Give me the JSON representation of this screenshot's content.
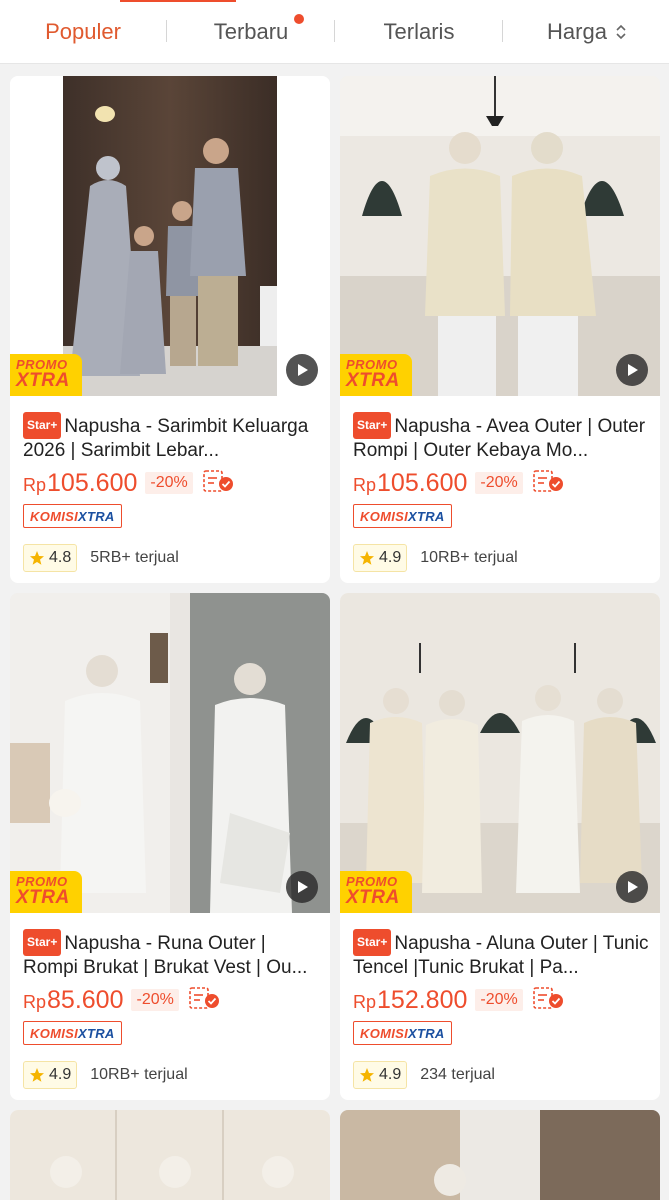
{
  "sort_tabs": [
    {
      "label": "Populer",
      "active": true
    },
    {
      "label": "Terbaru",
      "has_dot": true
    },
    {
      "label": "Terlaris"
    },
    {
      "label": "Harga",
      "icon": "sort-updown-icon"
    }
  ],
  "colors": {
    "accent": "#ee4d2d",
    "promo_yellow": "#ffd100",
    "komisi_blue": "#1a4fa0"
  },
  "labels": {
    "promo_line1": "PROMO",
    "promo_line2": "XTRA",
    "star_badge": "Star+",
    "currency": "Rp",
    "komisi_part1": "KOMISI",
    "komisi_part2": "XTRA"
  },
  "products": [
    {
      "title": "Napusha - Sarimbit Keluarga 2026 | Sarimbit Lebar...",
      "price": "105.600",
      "discount": "-20%",
      "rating": "4.8",
      "sold": "5RB+ terjual"
    },
    {
      "title": "Napusha - Avea Outer | Outer Rompi | Outer Kebaya Mo...",
      "price": "105.600",
      "discount": "-20%",
      "rating": "4.9",
      "sold": "10RB+ terjual"
    },
    {
      "title": "Napusha - Runa Outer | Rompi Brukat | Brukat Vest | Ou...",
      "price": "85.600",
      "discount": "-20%",
      "rating": "4.9",
      "sold": "10RB+ terjual"
    },
    {
      "title": "Napusha - Aluna Outer | Tunic Tencel |Tunic Brukat | Pa...",
      "price": "152.800",
      "discount": "-20%",
      "rating": "4.9",
      "sold": "234 terjual"
    }
  ]
}
